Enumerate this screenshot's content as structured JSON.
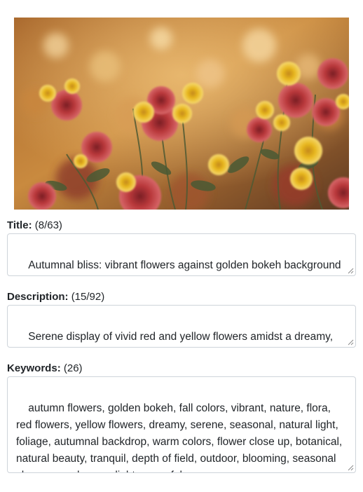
{
  "image": {
    "subject": "red and yellow flowers against golden autumn bokeh"
  },
  "fields": {
    "title": {
      "label": "Title:",
      "count": "(8/63)",
      "value": "Autumnal bliss: vibrant flowers against golden bokeh background"
    },
    "description": {
      "label": "Description:",
      "count": "(15/92)",
      "value": "Serene display of vivid red and yellow flowers amidst a dreamy, golden autumn bokeh backdrop"
    },
    "keywords": {
      "label": "Keywords:",
      "count": "(26)",
      "value": "autumn flowers, golden bokeh, fall colors, vibrant, nature, flora, red flowers, yellow flowers, dreamy, serene, seasonal, natural light, foliage, autumnal backdrop, warm colors, flower close up, botanical, natural beauty, tranquil, depth of field, outdoor, blooming, seasonal change, garden, sunlight, peaceful"
    }
  },
  "colors": {
    "border": "#ced4da",
    "text": "#212529",
    "flower_red": "#b8373a",
    "flower_yellow": "#e8b820",
    "bokeh_gold": "#d9a14a"
  }
}
